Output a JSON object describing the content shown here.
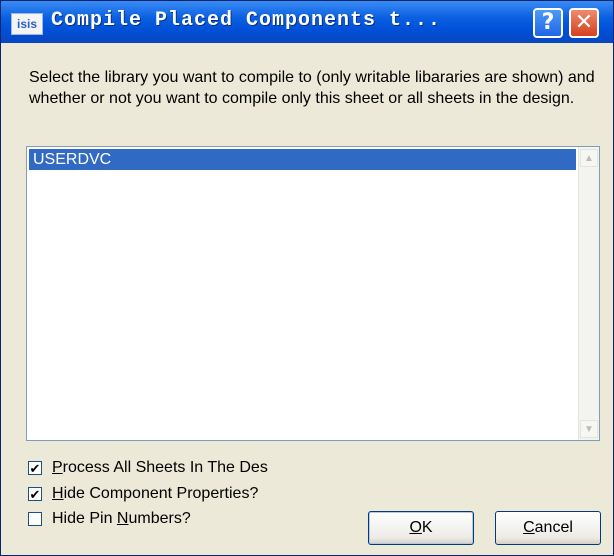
{
  "window": {
    "title": "Compile Placed Components t...",
    "app_icon_text": "isis",
    "help_glyph": "?",
    "close_glyph": "✕"
  },
  "description": "Select the library you want to compile to (only writable libararies are shown) and whether or not you want to compile only this sheet or all sheets in the design.",
  "library_list": {
    "items": [
      {
        "label": "USERDVC",
        "selected": true
      }
    ]
  },
  "options": [
    {
      "pre": "",
      "ul": "P",
      "post": "rocess All Sheets In The Des",
      "checked": true
    },
    {
      "pre": "",
      "ul": "H",
      "post": "ide Component Properties?",
      "checked": true
    },
    {
      "pre": "Hide Pin ",
      "ul": "N",
      "post": "umbers?",
      "checked": false
    }
  ],
  "buttons": {
    "ok": {
      "ul": "O",
      "rest": "K"
    },
    "cancel": {
      "ul": "C",
      "rest": "ancel"
    }
  }
}
